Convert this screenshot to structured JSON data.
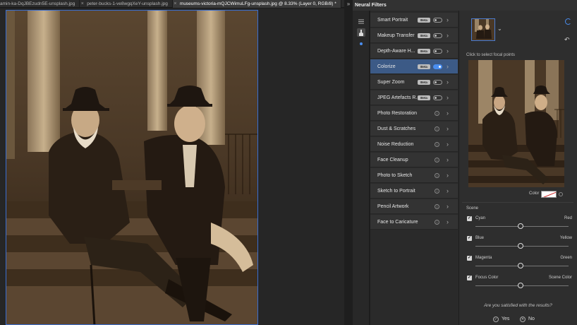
{
  "tabs": [
    {
      "label": "amin-ka-DqJBEzudn5E-unsplash.jpg",
      "active": false
    },
    {
      "label": "peter-bucks-1-ve8wgqXeY-unsplash.jpg",
      "active": false
    },
    {
      "label": "museums-victoria-mQJCWimuLFg-unsplash.jpg @ 8.33% (Layer 0, RGB/8) *",
      "active": true
    }
  ],
  "tab_overflow": "»",
  "panel": {
    "title": "Neural Filters"
  },
  "filters": [
    {
      "name": "Smart Portrait",
      "badge": "Beta",
      "toggle": "off"
    },
    {
      "name": "Makeup Transfer",
      "badge": "Beta",
      "toggle": "off"
    },
    {
      "name": "Depth-Aware H...",
      "badge": "Beta",
      "toggle": "off"
    },
    {
      "name": "Colorize",
      "badge": "Beta",
      "toggle": "on",
      "active": true
    },
    {
      "name": "Super Zoom",
      "badge": "Beta",
      "toggle": "off"
    },
    {
      "name": "JPEG Artefacts R...",
      "badge": "Beta",
      "toggle": "off"
    },
    {
      "name": "Photo Restoration",
      "badge": "",
      "toggle": "info"
    },
    {
      "name": "Dust & Scratches",
      "badge": "",
      "toggle": "info"
    },
    {
      "name": "Noise Reduction",
      "badge": "",
      "toggle": "info"
    },
    {
      "name": "Face Cleanup",
      "badge": "",
      "toggle": "info"
    },
    {
      "name": "Photo to Sketch",
      "badge": "",
      "toggle": "info"
    },
    {
      "name": "Sketch to Portrait",
      "badge": "",
      "toggle": "info"
    },
    {
      "name": "Pencil Artwork",
      "badge": "",
      "toggle": "info"
    },
    {
      "name": "Face to Caricature",
      "badge": "",
      "toggle": "info"
    }
  ],
  "settings": {
    "focal_hint": "Click to select focal points",
    "color_label": "Color",
    "scene_label": "Scene",
    "sliders": [
      {
        "left": "Cyan",
        "right": "Red",
        "value": 0.5,
        "checked": true
      },
      {
        "left": "Blue",
        "right": "Yellow",
        "value": 0.5,
        "checked": true
      },
      {
        "left": "Magenta",
        "right": "Green",
        "value": 0.5,
        "checked": true
      },
      {
        "left": "Focus Color",
        "right": "Scene Color",
        "value": 0.5,
        "checked": true
      }
    ],
    "question": "Are you satisfied with the results?",
    "yes_label": "Yes",
    "no_label": "No"
  },
  "colors": {
    "accent": "#4a8ef0",
    "selected_row": "#3c5a86",
    "photo_tone": "#6b4c30"
  }
}
